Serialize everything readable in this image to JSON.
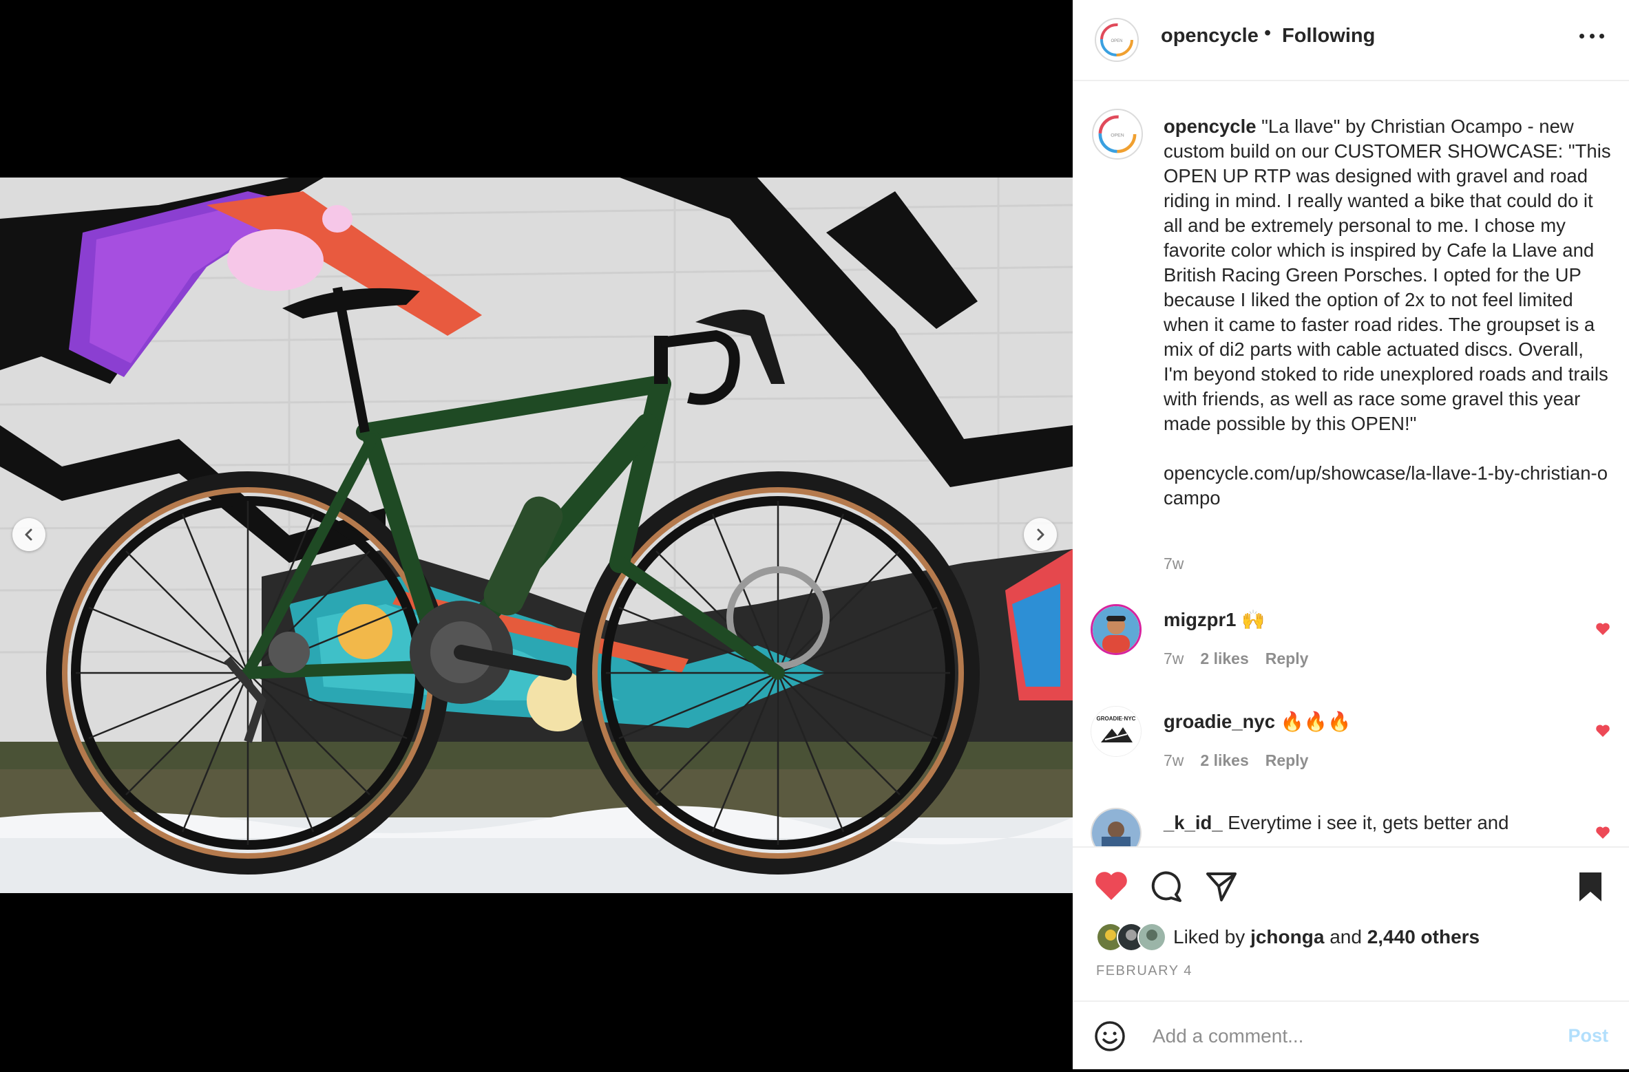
{
  "post": {
    "username": "opencycle",
    "follow_status": "Following",
    "separator": "•",
    "caption_user": "opencycle",
    "caption_text": "\"La llave\" by Christian Ocampo - new custom build on our CUSTOMER SHOWCASE: \"This OPEN UP RTP was designed with gravel and road riding in mind. I really wanted a bike that could do it all and be extremely personal to me. I chose my favorite color which is inspired by Cafe la Llave and British Racing Green Porsches. I opted for the UP because I liked the option of 2x to not feel limited when it came to faster road rides. The groupset is a mix of di2 parts with cable actuated discs. Overall, I'm beyond stoked to ride unexplored roads and trails with friends, as well as race some gravel this year made possible by this OPEN!\"",
    "caption_link": "opencycle.com/up/showcase/la-llave-1-by-christian-ocampo",
    "caption_time": "7w",
    "avatar_logo_text": "OPEN"
  },
  "comments": [
    {
      "user": "migzpr1",
      "text": "🙌",
      "time": "7w",
      "likes": "2 likes",
      "reply": "Reply"
    },
    {
      "user": "groadie_nyc",
      "text": "🔥🔥🔥",
      "time": "7w",
      "likes": "2 likes",
      "reply": "Reply",
      "avatar_text": "GROADIE·NYC"
    },
    {
      "user": "_k_id_",
      "text": "Everytime i see it, gets better and"
    }
  ],
  "likes": {
    "prefix": "Liked by",
    "user": "jchonga",
    "middle": "and",
    "others": "2,440 others"
  },
  "date": "FEBRUARY 4",
  "comment_input": {
    "placeholder": "Add a comment...",
    "post_label": "Post"
  },
  "colors": {
    "like_red": "#ed4956",
    "bike_green": "#1f4a24",
    "post_blue": "#b2dffc"
  },
  "icons": [
    "heart-icon",
    "comment-icon",
    "share-icon",
    "bookmark-icon",
    "emoji-icon",
    "more-icon",
    "chevron-left-icon",
    "chevron-right-icon"
  ]
}
